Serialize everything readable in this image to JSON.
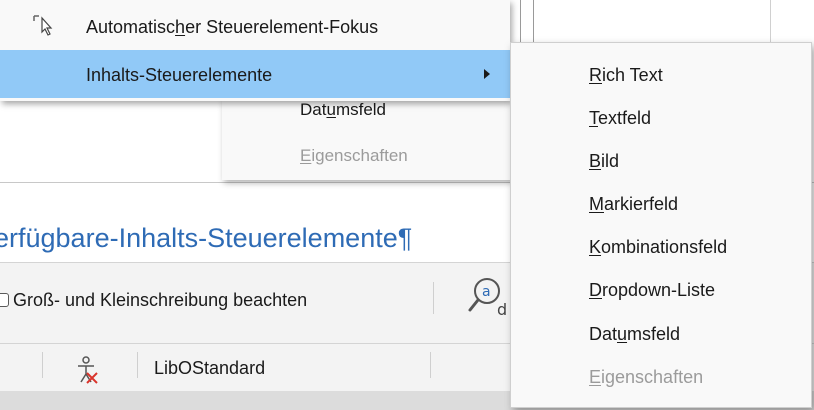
{
  "document": {
    "heading": "erfügbare-Inhalts-Steuerelemente¶"
  },
  "findbar": {
    "match_case_label": "Groß- und Kleinschreibung beachten"
  },
  "statusbar": {
    "page_style": "LibOStandard"
  },
  "parent_menu": {
    "items": [
      {
        "pre": "Automatisc",
        "mn": "h",
        "post": "er Steuerelement-Fokus"
      },
      {
        "pre": "",
        "mn": "",
        "post": "Inhalts-Steuerelemente",
        "active": true
      }
    ]
  },
  "old_submenu": {
    "items": [
      {
        "pre": "Dat",
        "mn": "u",
        "post": "msfeld",
        "disabled": false
      },
      {
        "pre": "",
        "mn": "E",
        "post": "igenschaften",
        "disabled": true
      }
    ]
  },
  "submenu": {
    "items": [
      {
        "pre": "",
        "mn": "R",
        "post": "ich Text",
        "disabled": false
      },
      {
        "pre": "",
        "mn": "T",
        "post": "extfeld",
        "disabled": false
      },
      {
        "pre": "",
        "mn": "B",
        "post": "ild",
        "disabled": false
      },
      {
        "pre": "",
        "mn": "M",
        "post": "arkierfeld",
        "disabled": false
      },
      {
        "pre": "",
        "mn": "K",
        "post": "ombinationsfeld",
        "disabled": false
      },
      {
        "pre": "",
        "mn": "D",
        "post": "ropdown-Liste",
        "disabled": false
      },
      {
        "pre": "Dat",
        "mn": "u",
        "post": "msfeld",
        "disabled": false
      },
      {
        "pre": "",
        "mn": "E",
        "post": "igenschaften",
        "disabled": true
      }
    ]
  },
  "colors": {
    "highlight": "#91c9f7",
    "heading": "#2e6bb5",
    "disabled": "#9b9b9b"
  }
}
